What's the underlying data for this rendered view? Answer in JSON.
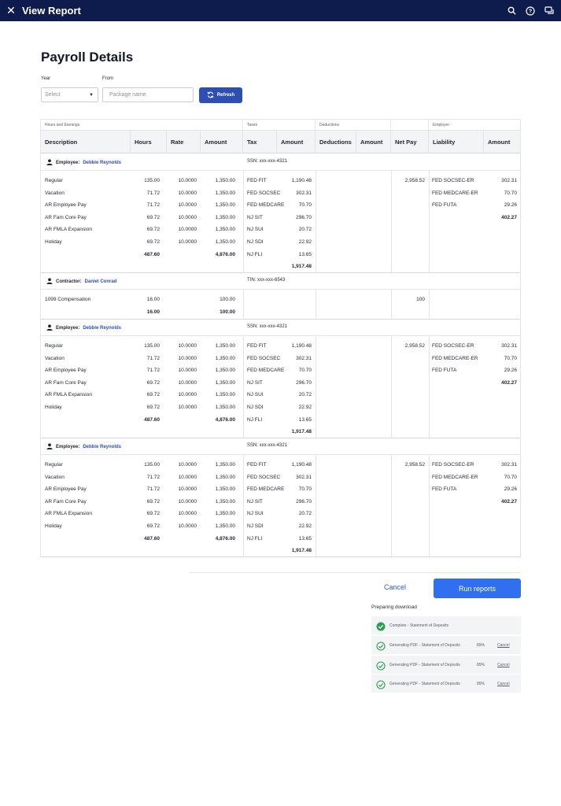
{
  "app": {
    "title": "View Report"
  },
  "page": {
    "title": "Payroll Details"
  },
  "filters": {
    "year_label": "Year",
    "from_label": "From",
    "year_placeholder": "Select",
    "package_placeholder": "Package name",
    "refresh_label": "Refresh"
  },
  "table": {
    "groups": [
      "Hours and Earnings",
      "Taxes",
      "Deductions",
      "",
      "Employer"
    ],
    "headers": [
      "Description",
      "Hours",
      "Rate",
      "Amount",
      "Tax",
      "Amount",
      "Deductions",
      "Amount",
      "Net Pay",
      "Liability",
      "Amount"
    ],
    "sections": [
      {
        "role": "Employee:",
        "name": "Debbie Reynolds",
        "id": "SSN: xxx-xxx-4321",
        "earnings": [
          [
            "Regular",
            "135.00",
            "10.0000",
            "1,350.00"
          ],
          [
            "Vacation",
            "71.72",
            "10.0000",
            "1,350.00"
          ],
          [
            "AR Employee Pay",
            "71.72",
            "10.0000",
            "1,350.00"
          ],
          [
            "AR Fam Core Pay",
            "69.72",
            "10.0000",
            "1,350.00"
          ],
          [
            "AR FMLA Expansion",
            "69.72",
            "10.0000",
            "1,350.00"
          ],
          [
            "Holiday",
            "69.72",
            "10.0000",
            "1,350.00"
          ]
        ],
        "hours_total": "487.60",
        "amount_total": "4,876.00",
        "taxes": [
          [
            "FED FIT",
            "1,190.48"
          ],
          [
            "FED SOCSEC",
            "302.31"
          ],
          [
            "FED MEDCARE",
            "70.70"
          ],
          [
            "NJ SIT",
            "296.70"
          ],
          [
            "NJ SUI",
            "20.72"
          ],
          [
            "NJ SDI",
            "22.92"
          ],
          [
            "NJ FLI",
            "13.65"
          ]
        ],
        "tax_total": "1,917.48",
        "net_pay": "2,958.52",
        "liabilities": [
          [
            "FED SOCSEC-ER",
            "302.31"
          ],
          [
            "FED MEDCARE-ER",
            "70.70"
          ],
          [
            "FED FUTA",
            "29.26"
          ]
        ],
        "liability_total": "402.27"
      },
      {
        "role": "Contractor:",
        "name": "Daniel Conrad",
        "id": "TIN: xxx-xxx-6543",
        "earnings": [
          [
            "1099 Compensation",
            "16.00",
            "",
            "100.00"
          ]
        ],
        "hours_total": "16.00",
        "amount_total": "100.00",
        "taxes": [],
        "tax_total": "",
        "net_pay": "100",
        "liabilities": [],
        "liability_total": ""
      },
      {
        "role": "Employee:",
        "name": "Debbie Reynolds",
        "id": "SSN: xxx-xxx-4321",
        "earnings": [
          [
            "Regular",
            "135.00",
            "10.0000",
            "1,350.00"
          ],
          [
            "Vacation",
            "71.72",
            "10.0000",
            "1,350.00"
          ],
          [
            "AR Employee Pay",
            "71.72",
            "10.0000",
            "1,350.00"
          ],
          [
            "AR Fam Core Pay",
            "69.72",
            "10.0000",
            "1,350.00"
          ],
          [
            "AR FMLA Expansion",
            "69.72",
            "10.0000",
            "1,350.00"
          ],
          [
            "Holiday",
            "69.72",
            "10.0000",
            "1,350.00"
          ]
        ],
        "hours_total": "487.60",
        "amount_total": "4,876.00",
        "taxes": [
          [
            "FED FIT",
            "1,190.48"
          ],
          [
            "FED SOCSEC",
            "302.31"
          ],
          [
            "FED MEDCARE",
            "70.70"
          ],
          [
            "NJ SIT",
            "296.70"
          ],
          [
            "NJ SUI",
            "20.72"
          ],
          [
            "NJ SDI",
            "22.92"
          ],
          [
            "NJ FLI",
            "13.65"
          ]
        ],
        "tax_total": "1,917.48",
        "net_pay": "2,958.52",
        "liabilities": [
          [
            "FED SOCSEC-ER",
            "302.31"
          ],
          [
            "FED MEDCARE-ER",
            "70.70"
          ],
          [
            "FED FUTA",
            "29.26"
          ]
        ],
        "liability_total": "402.27"
      },
      {
        "role": "Employee:",
        "name": "Debbie Reynolds",
        "id": "SSN: xxx-xxx-4321",
        "earnings": [
          [
            "Regular",
            "135.00",
            "10.0000",
            "1,350.00"
          ],
          [
            "Vacation",
            "71.72",
            "10.0000",
            "1,350.00"
          ],
          [
            "AR Employee Pay",
            "71.72",
            "10.0000",
            "1,350.00"
          ],
          [
            "AR Fam Core Pay",
            "69.72",
            "10.0000",
            "1,350.00"
          ],
          [
            "AR FMLA Expansion",
            "69.72",
            "10.0000",
            "1,350.00"
          ],
          [
            "Holiday",
            "69.72",
            "10.0000",
            "1,350.00"
          ]
        ],
        "hours_total": "487.60",
        "amount_total": "4,876.00",
        "taxes": [
          [
            "FED FIT",
            "1,190.48"
          ],
          [
            "FED SOCSEC",
            "302.31"
          ],
          [
            "FED MEDCARE",
            "70.70"
          ],
          [
            "NJ SIT",
            "296.70"
          ],
          [
            "NJ SUI",
            "20.72"
          ],
          [
            "NJ SDI",
            "22.92"
          ],
          [
            "NJ FLI",
            "13.65"
          ]
        ],
        "tax_total": "1,917.48",
        "net_pay": "2,958.52",
        "liabilities": [
          [
            "FED SOCSEC-ER",
            "302.31"
          ],
          [
            "FED MEDCARE-ER",
            "70.70"
          ],
          [
            "FED FUTA",
            "29.26"
          ]
        ],
        "liability_total": "402.27"
      }
    ]
  },
  "actions": {
    "cancel_label": "Cancel",
    "run_label": "Run reports"
  },
  "downloads": {
    "label": "Preparing download",
    "items": [
      {
        "text": "Complete - Statement of Deposits",
        "status": "complete",
        "percent": "",
        "cancel": ""
      },
      {
        "text": "Generating PDF - Statement of Deposits",
        "status": "generating",
        "percent": "89%",
        "cancel": "Cancel"
      },
      {
        "text": "Generating PDF - Statement of Deposits",
        "status": "generating",
        "percent": "89%",
        "cancel": "Cancel"
      },
      {
        "text": "Generating PDF - Statement of Deposits",
        "status": "generating",
        "percent": "89%",
        "cancel": "Cancel"
      }
    ]
  },
  "colors": {
    "topbar": "#0e1b4d",
    "primary": "#2f6ff0",
    "success": "#2e9e4f",
    "link": "#2d4fb5"
  },
  "icons": {
    "close": "close-icon",
    "search": "search-icon",
    "help": "help-icon",
    "chat": "chat-icon",
    "refresh": "refresh-icon",
    "person": "person-icon",
    "check": "check-circle-icon"
  }
}
